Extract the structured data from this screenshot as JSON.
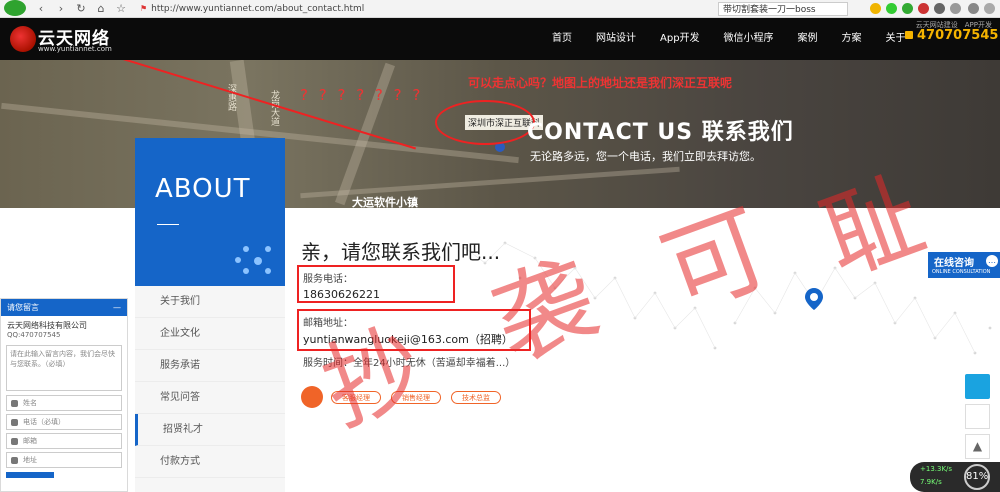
{
  "browser": {
    "url": "http://www.yuntiannet.com/about_contact.html",
    "tab_title": "带切割套装一刀一boss"
  },
  "header": {
    "logo_name": "云天网络",
    "logo_url": "www.yuntiannet.com",
    "nav": [
      "首页",
      "网站设计",
      "App开发",
      "微信小程序",
      "案例",
      "方案",
      "关于"
    ],
    "phone": "470707545",
    "mini_links": "云天网站建设　APP开发"
  },
  "banner": {
    "question_marks": "? ? ? ? ? ? ?",
    "annotation": "可以走点心吗？地图上的地址还是我们深正互联呢",
    "map_label": "深圳市深正互联科",
    "map_places": [
      "龙岗大道",
      "大运软件小镇",
      "深惠路"
    ],
    "title": "CONTACT US  联系我们",
    "subtitle": "无论路多远，您一个电话，我们立即去拜访您。"
  },
  "about": {
    "title": "ABOUT",
    "menu": [
      "关于我们",
      "企业文化",
      "服务承诺",
      "常见问答",
      "招贤礼才",
      "付款方式"
    ]
  },
  "message": {
    "header": "请您留言",
    "company": "云天网络科技有限公司",
    "qq": "QQ:470707545",
    "textarea_placeholder": "请在此输入留言内容，我们会尽快与您联系。（必填）",
    "fields": [
      "姓名",
      "电话（必填）",
      "邮箱",
      "地址"
    ]
  },
  "contact": {
    "heading": "亲，请您联系我们吧...",
    "phone_label": "服务电话：",
    "phone_value": "18630626221",
    "email_label": "邮箱地址：",
    "email_value": "yuntianwangluokeji@163.com（招聘）",
    "hours": "服务时间：全年24小时无休（苦逼却幸福着...）",
    "buttons": [
      "客服经理",
      "销售经理",
      "技术总监"
    ]
  },
  "watermark": [
    "抄",
    "袭",
    "可",
    "耻"
  ],
  "float": {
    "online_title": "在线咨询",
    "online_sub": "ONLINE CONSULTATION",
    "speed_up": "+13.3K/s",
    "speed_down": "7.9K/s",
    "percent": "81%"
  }
}
